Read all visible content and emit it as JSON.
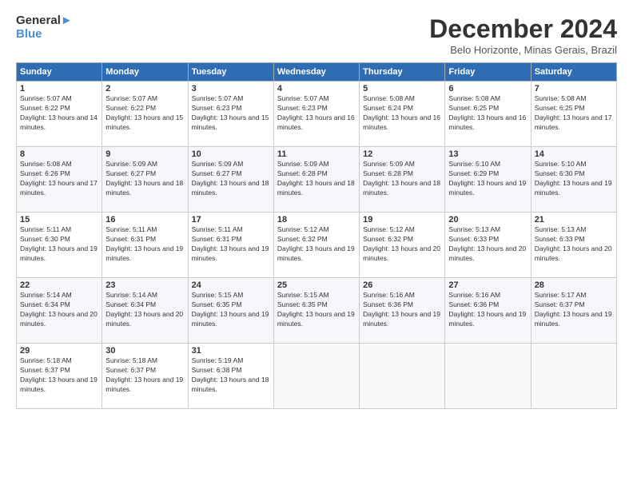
{
  "logo": {
    "line1": "General",
    "line2": "Blue"
  },
  "title": "December 2024",
  "location": "Belo Horizonte, Minas Gerais, Brazil",
  "days_of_week": [
    "Sunday",
    "Monday",
    "Tuesday",
    "Wednesday",
    "Thursday",
    "Friday",
    "Saturday"
  ],
  "weeks": [
    [
      {
        "day": "1",
        "sunrise": "5:07 AM",
        "sunset": "6:22 PM",
        "daylight": "13 hours and 14 minutes."
      },
      {
        "day": "2",
        "sunrise": "5:07 AM",
        "sunset": "6:22 PM",
        "daylight": "13 hours and 15 minutes."
      },
      {
        "day": "3",
        "sunrise": "5:07 AM",
        "sunset": "6:23 PM",
        "daylight": "13 hours and 15 minutes."
      },
      {
        "day": "4",
        "sunrise": "5:07 AM",
        "sunset": "6:23 PM",
        "daylight": "13 hours and 16 minutes."
      },
      {
        "day": "5",
        "sunrise": "5:08 AM",
        "sunset": "6:24 PM",
        "daylight": "13 hours and 16 minutes."
      },
      {
        "day": "6",
        "sunrise": "5:08 AM",
        "sunset": "6:25 PM",
        "daylight": "13 hours and 16 minutes."
      },
      {
        "day": "7",
        "sunrise": "5:08 AM",
        "sunset": "6:25 PM",
        "daylight": "13 hours and 17 minutes."
      }
    ],
    [
      {
        "day": "8",
        "sunrise": "5:08 AM",
        "sunset": "6:26 PM",
        "daylight": "13 hours and 17 minutes."
      },
      {
        "day": "9",
        "sunrise": "5:09 AM",
        "sunset": "6:27 PM",
        "daylight": "13 hours and 18 minutes."
      },
      {
        "day": "10",
        "sunrise": "5:09 AM",
        "sunset": "6:27 PM",
        "daylight": "13 hours and 18 minutes."
      },
      {
        "day": "11",
        "sunrise": "5:09 AM",
        "sunset": "6:28 PM",
        "daylight": "13 hours and 18 minutes."
      },
      {
        "day": "12",
        "sunrise": "5:09 AM",
        "sunset": "6:28 PM",
        "daylight": "13 hours and 18 minutes."
      },
      {
        "day": "13",
        "sunrise": "5:10 AM",
        "sunset": "6:29 PM",
        "daylight": "13 hours and 19 minutes."
      },
      {
        "day": "14",
        "sunrise": "5:10 AM",
        "sunset": "6:30 PM",
        "daylight": "13 hours and 19 minutes."
      }
    ],
    [
      {
        "day": "15",
        "sunrise": "5:11 AM",
        "sunset": "6:30 PM",
        "daylight": "13 hours and 19 minutes."
      },
      {
        "day": "16",
        "sunrise": "5:11 AM",
        "sunset": "6:31 PM",
        "daylight": "13 hours and 19 minutes."
      },
      {
        "day": "17",
        "sunrise": "5:11 AM",
        "sunset": "6:31 PM",
        "daylight": "13 hours and 19 minutes."
      },
      {
        "day": "18",
        "sunrise": "5:12 AM",
        "sunset": "6:32 PM",
        "daylight": "13 hours and 19 minutes."
      },
      {
        "day": "19",
        "sunrise": "5:12 AM",
        "sunset": "6:32 PM",
        "daylight": "13 hours and 20 minutes."
      },
      {
        "day": "20",
        "sunrise": "5:13 AM",
        "sunset": "6:33 PM",
        "daylight": "13 hours and 20 minutes."
      },
      {
        "day": "21",
        "sunrise": "5:13 AM",
        "sunset": "6:33 PM",
        "daylight": "13 hours and 20 minutes."
      }
    ],
    [
      {
        "day": "22",
        "sunrise": "5:14 AM",
        "sunset": "6:34 PM",
        "daylight": "13 hours and 20 minutes."
      },
      {
        "day": "23",
        "sunrise": "5:14 AM",
        "sunset": "6:34 PM",
        "daylight": "13 hours and 20 minutes."
      },
      {
        "day": "24",
        "sunrise": "5:15 AM",
        "sunset": "6:35 PM",
        "daylight": "13 hours and 19 minutes."
      },
      {
        "day": "25",
        "sunrise": "5:15 AM",
        "sunset": "6:35 PM",
        "daylight": "13 hours and 19 minutes."
      },
      {
        "day": "26",
        "sunrise": "5:16 AM",
        "sunset": "6:36 PM",
        "daylight": "13 hours and 19 minutes."
      },
      {
        "day": "27",
        "sunrise": "5:16 AM",
        "sunset": "6:36 PM",
        "daylight": "13 hours and 19 minutes."
      },
      {
        "day": "28",
        "sunrise": "5:17 AM",
        "sunset": "6:37 PM",
        "daylight": "13 hours and 19 minutes."
      }
    ],
    [
      {
        "day": "29",
        "sunrise": "5:18 AM",
        "sunset": "6:37 PM",
        "daylight": "13 hours and 19 minutes."
      },
      {
        "day": "30",
        "sunrise": "5:18 AM",
        "sunset": "6:37 PM",
        "daylight": "13 hours and 19 minutes."
      },
      {
        "day": "31",
        "sunrise": "5:19 AM",
        "sunset": "6:38 PM",
        "daylight": "13 hours and 18 minutes."
      },
      null,
      null,
      null,
      null
    ]
  ],
  "labels": {
    "sunrise": "Sunrise:",
    "sunset": "Sunset:",
    "daylight": "Daylight:"
  }
}
